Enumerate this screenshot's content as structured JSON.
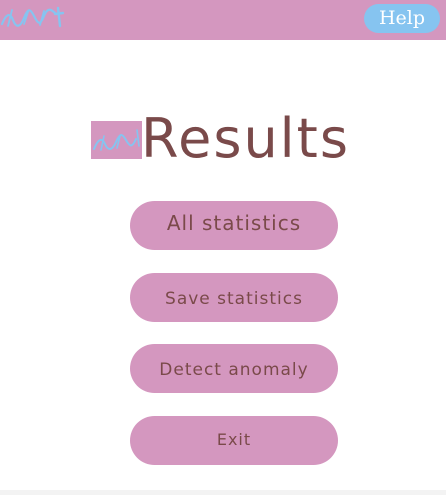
{
  "header": {
    "logo_icon": "app-logo",
    "help_label": "Help"
  },
  "main": {
    "title": "Results",
    "title_logo_icon": "app-logo",
    "buttons": {
      "all_statistics": "All statistics",
      "save_statistics": "Save statistics",
      "detect_anomaly": "Detect anomaly",
      "exit": "Exit"
    }
  },
  "colors": {
    "bar": "#d497bf",
    "button": "#d497bf",
    "help_button": "#86c4f0",
    "text": "#7a4a4a",
    "background": "#ffffff"
  }
}
